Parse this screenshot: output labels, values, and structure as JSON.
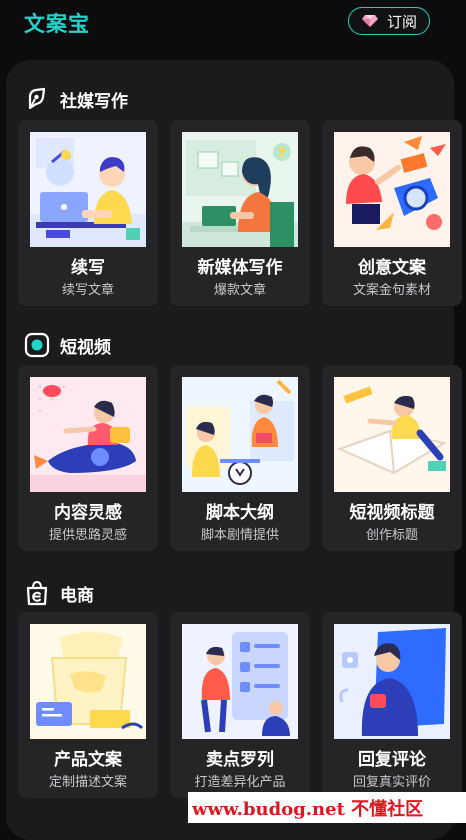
{
  "header": {
    "app_name": "文案宝",
    "subscribe_label": "订阅",
    "subscribe_icon": "diamond-icon"
  },
  "sections": [
    {
      "title": "社媒写作",
      "icon": "pen-nib-icon",
      "cards": [
        {
          "title": "续写",
          "subtitle": "续写文章"
        },
        {
          "title": "新媒体写作",
          "subtitle": "爆款文章"
        },
        {
          "title": "创意文案",
          "subtitle": "文案金句素材"
        }
      ]
    },
    {
      "title": "短视频",
      "icon": "record-icon",
      "cards": [
        {
          "title": "内容灵感",
          "subtitle": "提供思路灵感"
        },
        {
          "title": "脚本大纲",
          "subtitle": "脚本剧情提供"
        },
        {
          "title": "短视频标题",
          "subtitle": "创作标题"
        }
      ]
    },
    {
      "title": "电商",
      "icon": "shopping-bag-icon",
      "cards": [
        {
          "title": "产品文案",
          "subtitle": "定制描述文案"
        },
        {
          "title": "卖点罗列",
          "subtitle": "打造差异化产品"
        },
        {
          "title": "回复评论",
          "subtitle": "回复真实评价"
        }
      ]
    }
  ],
  "watermark": "www.budog.net 不懂社区",
  "colors": {
    "accent": "#21d3c8",
    "background": "#0c0c0e",
    "panel": "#1b1b1e",
    "card": "#252528"
  }
}
